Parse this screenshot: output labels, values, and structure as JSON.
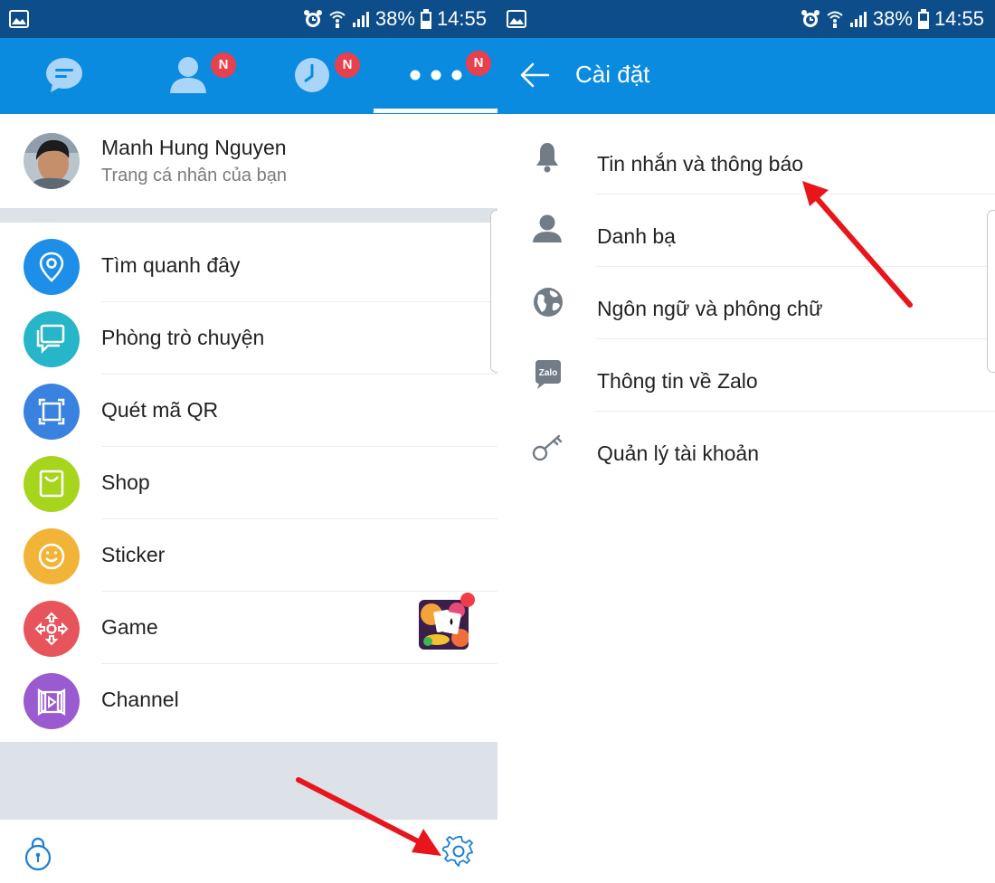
{
  "status_bar": {
    "battery": "38%",
    "time": "14:55"
  },
  "tabs": [
    {
      "name": "messages",
      "badge": ""
    },
    {
      "name": "contacts",
      "badge": "N"
    },
    {
      "name": "timeline",
      "badge": "N"
    },
    {
      "name": "more",
      "badge": "N"
    }
  ],
  "profile": {
    "name": "Manh Hung Nguyen",
    "subtitle": "Trang cá nhân của bạn"
  },
  "menu": [
    {
      "label": "Tìm quanh đây",
      "icon": "location-pin-icon",
      "color": "#1e8fe8"
    },
    {
      "label": "Phòng trò chuyện",
      "icon": "chat-room-icon",
      "color": "#26b5c9"
    },
    {
      "label": "Quét mã QR",
      "icon": "qr-scan-icon",
      "color": "#3a82e0"
    },
    {
      "label": "Shop",
      "icon": "shopping-bag-icon",
      "color": "#a7d41d"
    },
    {
      "label": "Sticker",
      "icon": "smiley-icon",
      "color": "#f2b437"
    },
    {
      "label": "Game",
      "icon": "gamepad-icon",
      "color": "#e8545c"
    },
    {
      "label": "Channel",
      "icon": "channel-play-icon",
      "color": "#9a5bd0"
    }
  ],
  "bottom": {
    "left_icon": "lock-icon",
    "right_icon": "gear-icon"
  },
  "settings": {
    "title": "Cài đặt",
    "items": [
      {
        "label": "Tin nhắn và thông báo",
        "icon": "bell-icon"
      },
      {
        "label": "Danh bạ",
        "icon": "person-icon"
      },
      {
        "label": "Ngôn ngữ và phông chữ",
        "icon": "globe-icon"
      },
      {
        "label": "Thông tin về Zalo",
        "icon": "zalo-icon"
      },
      {
        "label": "Quản lý tài khoản",
        "icon": "key-icon"
      }
    ]
  },
  "zalo_icon_text": "Zalo",
  "colors": {
    "app_bar": "#0a8be0",
    "status_bar": "#0c4d8a",
    "badge": "#e8404c",
    "annotation_arrow": "#e8161c"
  }
}
